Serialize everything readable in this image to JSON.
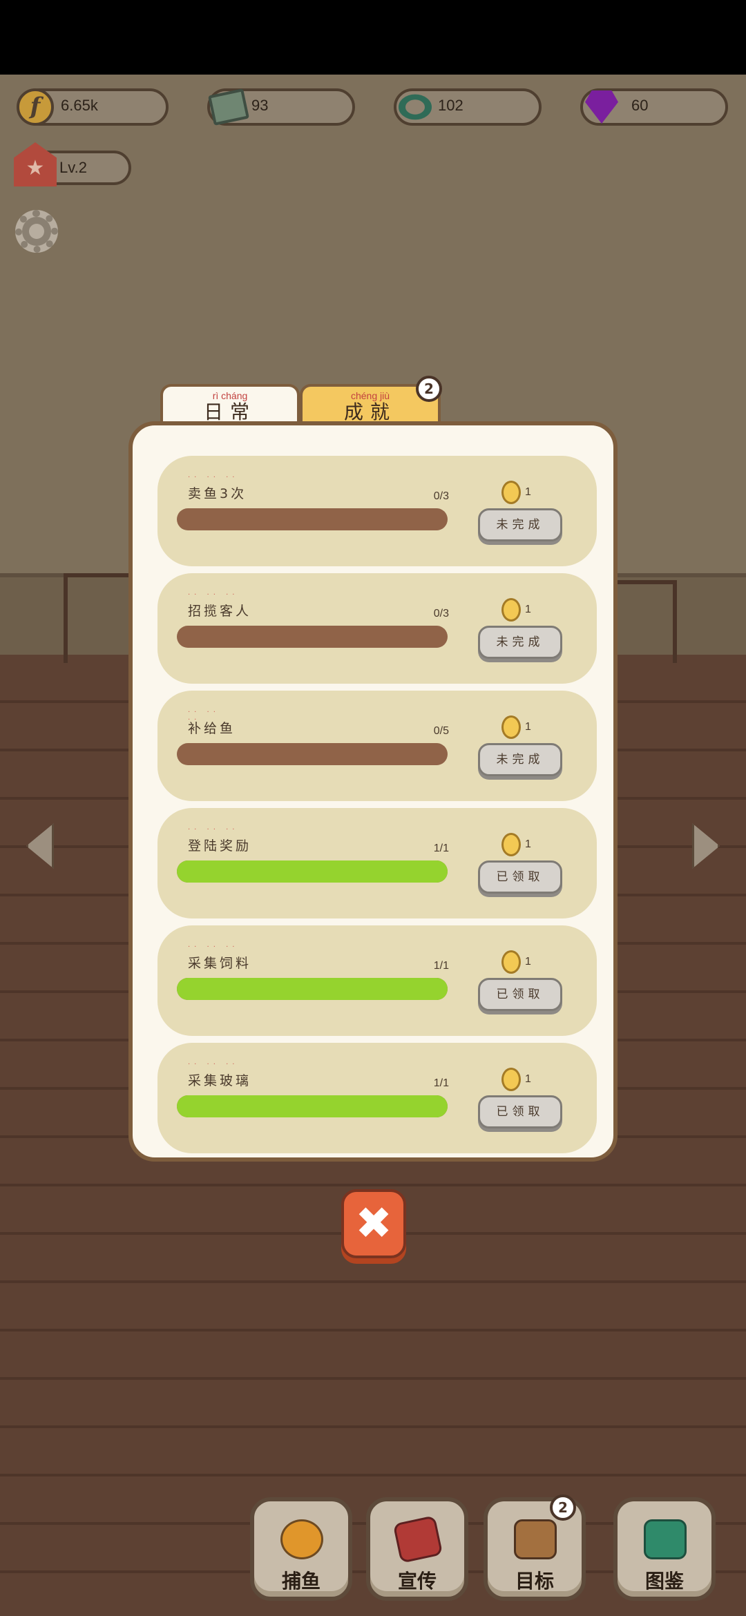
{
  "hud": {
    "coins": "6.65k",
    "books": "93",
    "rings": "102",
    "gems": "60",
    "level": "Lv.2"
  },
  "tabs": {
    "daily": {
      "pinyin": "rì cháng",
      "label": "日常"
    },
    "achievement": {
      "pinyin": "chéng jiù",
      "label": "成就",
      "badge": "2"
    }
  },
  "tasks": [
    {
      "name": "卖鱼3次",
      "progress": "0/3",
      "fill": 0,
      "reward": "1",
      "status": "未完成"
    },
    {
      "name": "招揽客人",
      "progress": "0/3",
      "fill": 0,
      "reward": "1",
      "status": "未完成"
    },
    {
      "name": "补给鱼",
      "progress": "0/5",
      "fill": 0,
      "reward": "1",
      "status": "未完成"
    },
    {
      "name": "登陆奖励",
      "progress": "1/1",
      "fill": 1,
      "reward": "1",
      "status": "已领取"
    },
    {
      "name": "采集饲料",
      "progress": "1/1",
      "fill": 1,
      "reward": "1",
      "status": "已领取"
    },
    {
      "name": "采集玻璃",
      "progress": "1/1",
      "fill": 1,
      "reward": "1",
      "status": "已领取"
    }
  ],
  "close_icon": "✖",
  "bottom_nav": [
    {
      "label": "捕鱼",
      "icon": "submarine-icon"
    },
    {
      "label": "宣传",
      "icon": "play-icon"
    },
    {
      "label": "目标",
      "icon": "clipboard-icon",
      "badge": "2"
    },
    {
      "label": "图鉴",
      "icon": "fish-book-icon"
    }
  ],
  "colors": {
    "panel_bg": "#fbf7ed",
    "card_bg": "#e6dcb6",
    "bar_empty": "#906348",
    "bar_full": "#95d32e",
    "tab_active": "#fbf7ed",
    "tab_inactive": "#f4c860",
    "close_button": "#e7643b"
  }
}
